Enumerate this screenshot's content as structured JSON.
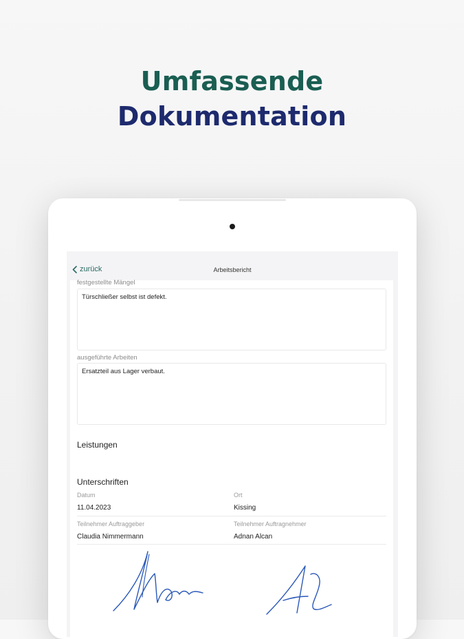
{
  "headline": {
    "line1": "Umfassende",
    "line2": "Dokumentation"
  },
  "nav": {
    "back_label": "zurück",
    "title": "Arbeitsbericht"
  },
  "form": {
    "maengel_label": "festgestellte Mängel",
    "maengel_value": "Türschließer selbst ist defekt.",
    "arbeiten_label": "ausgeführte Arbeiten",
    "arbeiten_value": "Ersatzteil aus Lager verbaut."
  },
  "leistungen_title": "Leistungen",
  "signatures": {
    "title": "Unterschriften",
    "datum_label": "Datum",
    "datum_value": "11.04.2023",
    "ort_label": "Ort",
    "ort_value": "Kissing",
    "auftraggeber_label": "Teilnehmer Auftraggeber",
    "auftraggeber_value": "Claudia Nimmermann",
    "auftragnehmer_label": "Teilnehmer Auftragnehmer",
    "auftragnehmer_value": "Adnan Alcan"
  },
  "colors": {
    "headline_green": "#1a5e52",
    "headline_navy": "#1d2a6d",
    "back_teal": "#2a6b64",
    "signature_blue": "#2a58b8"
  },
  "icons": {
    "back": "chevron-left-icon"
  }
}
